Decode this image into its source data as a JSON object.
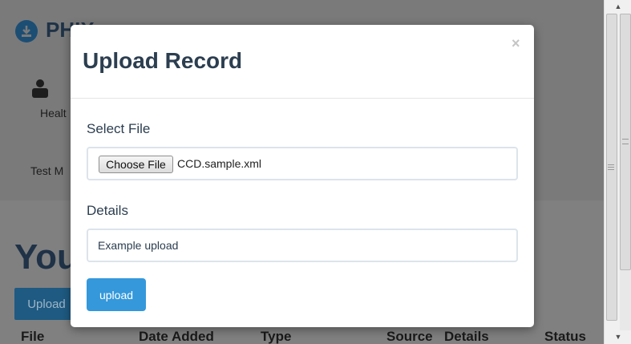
{
  "background": {
    "brand": "PHIX",
    "nav_label": "Healt",
    "user_name": "Test M",
    "heading": "You",
    "upload_button": "Upload",
    "table_headers": [
      "File",
      "Date Added",
      "Type",
      "Source",
      "Details",
      "Status"
    ]
  },
  "modal": {
    "title": "Upload Record",
    "close": "×",
    "select_file_label": "Select File",
    "choose_file_button": "Choose File",
    "file_name": "CCD.sample.xml",
    "details_label": "Details",
    "details_value": "Example upload",
    "upload_button": "upload"
  },
  "colors": {
    "overlay": "#7f7f7f",
    "primary": "#3498db",
    "title": "#2c3e50"
  },
  "icons": {
    "logo": "download-icon",
    "nav": "person-icon"
  }
}
